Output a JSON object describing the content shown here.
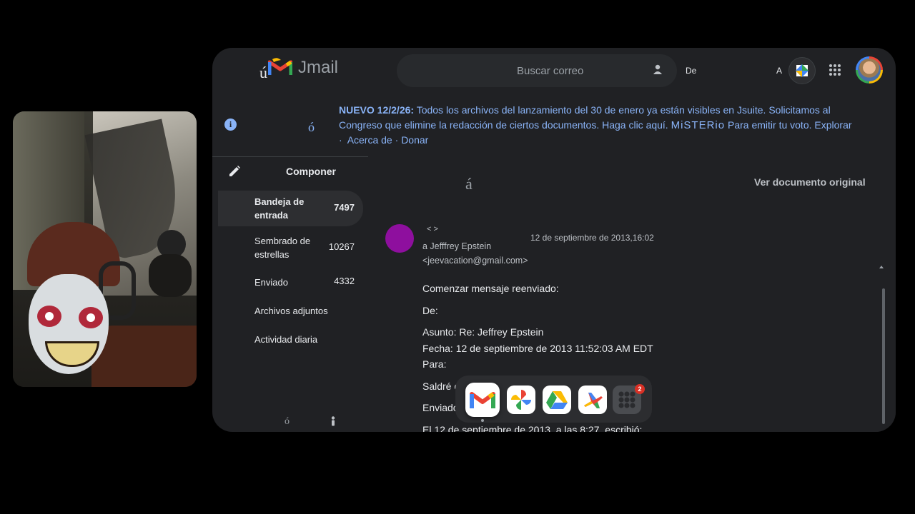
{
  "app": {
    "name": "Jmail",
    "logo_accent": "ú"
  },
  "search": {
    "placeholder": "Buscar correo",
    "from_label": "De",
    "a_label": "A"
  },
  "banner": {
    "accent": "ó",
    "bold": "NUEVO 12/2/26:",
    "text_1": "Todos los archivos del lanzamiento del 30 de enero ya están visibles en Jsuite. Solicitamos al Congreso que elimine la redacción de ciertos documentos. Haga clic aquí.",
    "misterio": "MiSTERio",
    "text_2": "Para emitir tu voto.",
    "explore": "Explorar",
    "sep": "·",
    "about": "Acerca de",
    "donate": "Donar"
  },
  "sidebar": {
    "compose": "Componer",
    "items": [
      {
        "label": "Bandeja de entrada",
        "count": "7497"
      },
      {
        "label": "Sembrado de estrellas",
        "count": "10267"
      },
      {
        "label": "Enviado",
        "count": "4332"
      },
      {
        "label": "Archivos adjuntos",
        "count": ""
      },
      {
        "label": "Actividad diaria",
        "count": ""
      }
    ],
    "bottom_accent": "ó"
  },
  "message": {
    "accent": "á",
    "view_original": "Ver documento original",
    "angles": "< >",
    "to_line_1": "a Jefffrey Epstein",
    "to_line_2": "<jeevacation@gmail.com>",
    "date": "12 de septiembre de 2013,16:02",
    "body": [
      "Comenzar mensaje reenviado:",
      "De:",
      "Asunto: Re: Jeffrey Epstein",
      "Fecha: 12 de septiembre de 2013 11:52:03 AM EDT",
      "Para:",
      "Saldré el",
      "Enviado",
      "El 12 de septiembre de 2013, a las 8:27, escribió:"
    ],
    "avatar_color": "#8e0f9e"
  },
  "dock": {
    "apps": [
      "gmail-icon",
      "photos-icon",
      "drive-icon",
      "flights-icon",
      "apps-grid-icon"
    ],
    "badge": "2"
  },
  "colors": {
    "background": "#000000",
    "window": "#202124",
    "link": "#8ab4f8",
    "text": "#e8eaed"
  }
}
